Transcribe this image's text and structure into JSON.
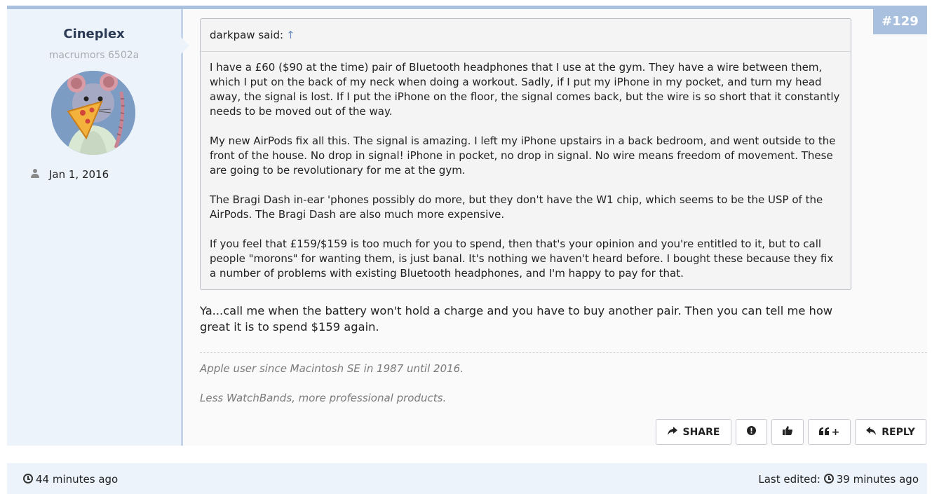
{
  "post": {
    "number": "#129",
    "author": {
      "name": "Cineplex",
      "title": "macrumors 6502a",
      "joined": "Jan 1, 2016"
    },
    "quote": {
      "author_line": "darkpaw said:",
      "up_arrow": "↑",
      "paragraphs": [
        "I have a £60 ($90 at the time) pair of Bluetooth headphones that I use at the gym. They have a wire between them, which I put on the back of my neck when doing a workout. Sadly, if I put my iPhone in my pocket, and turn my head away, the signal is lost. If I put the iPhone on the floor, the signal comes back, but the wire is so short that it constantly needs to be moved out of the way.",
        "My new AirPods fix all this. The signal is amazing. I left my iPhone upstairs in a back bedroom, and went outside to the front of the house. No drop in signal! iPhone in pocket, no drop in signal. No wire means freedom of movement. These are going to be revolutionary for me at the gym.",
        "The Bragi Dash in-ear 'phones possibly do more, but they don't have the W1 chip, which seems to be the USP of the AirPods. The Bragi Dash are also much more expensive.",
        "If you feel that £159/$159 is too much for you to spend, then that's your opinion and you're entitled to it, but to call people \"morons\" for wanting them, is just banal. It's nothing we haven't heard before. I bought these because they fix a number of problems with existing Bluetooth headphones, and I'm happy to pay for that."
      ]
    },
    "body": "Ya...call me when the battery won't hold a charge and you have to buy another pair. Then you can tell me how great it is to spend $159 again.",
    "signature": [
      "Apple user since Macintosh SE in 1987 until 2016.",
      "Less WatchBands, more professional products."
    ],
    "actions": {
      "share": "SHARE",
      "report_icon": "exclamation-circle-icon",
      "like_icon": "thumbs-up-icon",
      "quote_icon": "quote-icon",
      "quote_plus": "+",
      "reply": "REPLY"
    }
  },
  "footer": {
    "posted": "44 minutes ago",
    "last_edited_label": "Last edited:",
    "last_edited": "39 minutes ago"
  },
  "colors": {
    "accent": "#a9c0de",
    "user_panel": "#edf3fb",
    "username": "#2b3a55"
  }
}
